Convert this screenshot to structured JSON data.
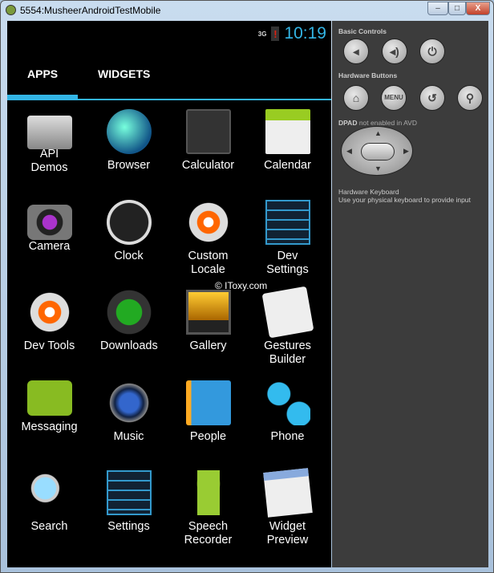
{
  "window": {
    "title": "5554:MusheerAndroidTestMobile",
    "minimize": "–",
    "maximize": "□",
    "close": "X"
  },
  "status": {
    "network": "3G",
    "battery_alert": "!",
    "time": "10:19"
  },
  "tabs": [
    {
      "label": "APPS",
      "selected": true
    },
    {
      "label": "WIDGETS",
      "selected": false
    }
  ],
  "apps": [
    {
      "label": "API Demos",
      "icon": "folder-gear-icon"
    },
    {
      "label": "Browser",
      "icon": "globe-icon"
    },
    {
      "label": "Calculator",
      "icon": "calculator-icon"
    },
    {
      "label": "Calendar",
      "icon": "calendar-icon"
    },
    {
      "label": "Camera",
      "icon": "camera-icon"
    },
    {
      "label": "Clock",
      "icon": "clock-icon"
    },
    {
      "label": "Custom Locale",
      "icon": "gear-icon"
    },
    {
      "label": "Dev Settings",
      "icon": "sliders-icon"
    },
    {
      "label": "Dev Tools",
      "icon": "gear-icon"
    },
    {
      "label": "Downloads",
      "icon": "download-icon"
    },
    {
      "label": "Gallery",
      "icon": "picture-icon"
    },
    {
      "label": "Gestures Builder",
      "icon": "gesture-icon"
    },
    {
      "label": "Messaging",
      "icon": "message-icon"
    },
    {
      "label": "Music",
      "icon": "speaker-icon"
    },
    {
      "label": "People",
      "icon": "contacts-icon"
    },
    {
      "label": "Phone",
      "icon": "phone-icon"
    },
    {
      "label": "Search",
      "icon": "magnifier-icon"
    },
    {
      "label": "Settings",
      "icon": "sliders-icon"
    },
    {
      "label": "Speech Recorder",
      "icon": "android-icon"
    },
    {
      "label": "Widget Preview",
      "icon": "widget-icon"
    }
  ],
  "watermark": "© IToxy.com",
  "panel": {
    "basic_controls": "Basic Controls",
    "hardware_buttons": "Hardware Buttons",
    "menu": "MENU",
    "dpad_bold": "DPAD",
    "dpad_note": " not enabled in AVD",
    "keyboard_title": "Hardware Keyboard",
    "keyboard_note": "Use your physical keyboard to provide input"
  }
}
